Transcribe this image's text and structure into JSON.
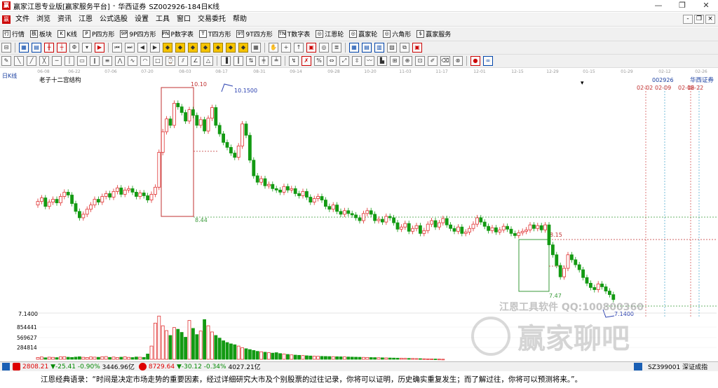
{
  "title": {
    "app": "赢家江恩专业版[赢家服务平台]",
    "security": "华西证券",
    "code_info": "SZ002926-184日K线",
    "controls": [
      "—",
      "❐",
      "✕"
    ]
  },
  "menu": {
    "items": [
      "文件",
      "浏览",
      "资讯",
      "江恩",
      "公式选股",
      "设置",
      "工具",
      "窗口",
      "交易委托",
      "帮助"
    ],
    "mdi_controls": [
      "-",
      "❐",
      "×"
    ]
  },
  "toolbar1": {
    "items": [
      {
        "icon": "行",
        "label": "行情"
      },
      {
        "icon": "板",
        "label": "板块"
      },
      {
        "icon": "K",
        "label": "K线"
      },
      {
        "icon": "P",
        "label": "P四方形"
      },
      {
        "icon": "9P",
        "label": "9P四方形"
      },
      {
        "icon": "PN",
        "label": "P数字表"
      },
      {
        "icon": "T",
        "label": "T四方形"
      },
      {
        "icon": "9T",
        "label": "9T四方形"
      },
      {
        "icon": "TN",
        "label": "T数字表"
      },
      {
        "icon": "◎",
        "label": "江恩轮"
      },
      {
        "icon": "◎",
        "label": "赢家轮"
      },
      {
        "icon": "◎",
        "label": "六角形"
      },
      {
        "icon": "$",
        "label": "赢家服务"
      }
    ]
  },
  "chart_data": {
    "type": "candlestick",
    "period_label": "日K线",
    "indicator_title": "老子十二宫结构",
    "stock_code": "002926",
    "stock_name": "华西证券",
    "date_ticks": [
      "06-08",
      "06-22",
      "07-06",
      "07-20",
      "08-03",
      "08-17",
      "08-31",
      "09-14",
      "09-28",
      "10-20",
      "11-03",
      "11-17",
      "12-01",
      "12-15",
      "12-29",
      "01-15",
      "01-29",
      "02-12",
      "02-26"
    ],
    "future_dates": [
      "02-02",
      "02-09",
      "02-16",
      "02-22"
    ],
    "price_labels": {
      "high_box": "10.10",
      "high_peak": "10.1500",
      "box_low": "8.44",
      "right_box_high": "8.15",
      "right_box_low": "7.47",
      "low_peak": "7.1400",
      "axis_low": "7.1400"
    },
    "volume_axis": [
      "854441",
      "569627",
      "284814"
    ],
    "ylim": [
      7.1,
      10.3
    ],
    "closes": [
      8.63,
      8.68,
      8.56,
      8.62,
      8.66,
      8.61,
      8.7,
      8.76,
      8.72,
      8.6,
      8.49,
      8.4,
      8.45,
      8.52,
      8.58,
      8.66,
      8.62,
      8.7,
      8.74,
      8.69,
      8.77,
      8.82,
      8.73,
      8.79,
      8.81,
      8.76,
      8.7,
      8.75,
      8.71,
      8.65,
      8.73,
      8.83,
      9.32,
      9.61,
      9.79,
      9.7,
      10.01,
      9.96,
      9.88,
      9.76,
      9.92,
      9.84,
      9.7,
      9.78,
      9.62,
      9.8,
      9.95,
      9.7,
      9.58,
      9.46,
      9.39,
      9.31,
      9.25,
      9.41,
      9.72,
      9.56,
      9.21,
      8.99,
      8.9,
      8.95,
      8.85,
      8.87,
      8.81,
      8.79,
      8.76,
      8.84,
      8.79,
      8.81,
      8.74,
      8.71,
      8.77,
      8.69,
      8.62,
      8.67,
      8.7,
      8.65,
      8.56,
      8.52,
      8.58,
      8.49,
      8.45,
      8.5,
      8.46,
      8.44,
      8.4,
      8.36,
      8.46,
      8.5,
      8.45,
      8.36,
      8.38,
      8.34,
      8.42,
      8.4,
      8.33,
      8.24,
      8.27,
      8.32,
      8.21,
      8.25,
      8.29,
      8.18,
      8.22,
      8.31,
      8.36,
      8.27,
      8.33,
      8.39,
      8.3,
      8.25,
      8.21,
      8.27,
      8.18,
      8.2,
      8.25,
      8.31,
      8.4,
      8.34,
      8.28,
      8.22,
      8.26,
      8.2,
      8.23,
      8.28,
      8.24,
      8.18,
      8.15,
      8.19,
      8.21,
      8.23,
      8.3,
      8.25,
      8.29,
      8.23,
      8.3,
      8.02,
      7.88,
      7.73,
      7.57,
      7.69,
      7.88,
      7.81,
      7.74,
      7.67,
      7.56,
      7.48,
      7.42,
      7.39,
      7.47,
      7.43,
      7.37,
      7.32,
      7.25
    ],
    "volumes": [
      40,
      52,
      35,
      48,
      44,
      38,
      55,
      60,
      47,
      42,
      50,
      58,
      46,
      41,
      53,
      49,
      45,
      57,
      62,
      43,
      51,
      39,
      48,
      56,
      44,
      40,
      52,
      47,
      43,
      120,
      300,
      820,
      980,
      760,
      650,
      540,
      720,
      680,
      610,
      500,
      880,
      700,
      560,
      640,
      900,
      760,
      620,
      540,
      480,
      420,
      380,
      350,
      330,
      300,
      260,
      240,
      220,
      200,
      180,
      170,
      160,
      150,
      140,
      150,
      130,
      120,
      110,
      100,
      95,
      90,
      85,
      80,
      75,
      70,
      68,
      66,
      64,
      62,
      60,
      58,
      56,
      54,
      52,
      50,
      48,
      46,
      44,
      42,
      40,
      38,
      36,
      34,
      32,
      30,
      28,
      26,
      24,
      22,
      20,
      18,
      16,
      14,
      12,
      10,
      8,
      6,
      4,
      2
    ]
  },
  "status": {
    "sh_index": "2808.21",
    "sh_change": "▼-25.41",
    "sh_pct": "-0.90%",
    "sh_amt": "3446.96亿",
    "sz_index": "8729.64",
    "sz_change": "▼-30.12",
    "sz_pct": "-0.34%",
    "sz_amt": "4027.21亿",
    "right": "SZ399001 深证成指"
  },
  "quote": "江恩经典语录：“时间是决定市场走势的重要因素，经过详细研究大市及个别股票的过往记录，你将可以证明，历史确实重复发生；而了解过往，你将可以预测将来。”。",
  "watermark": {
    "text": "赢家聊吧",
    "tool": "江恩工具软件  QQ:100800360"
  }
}
